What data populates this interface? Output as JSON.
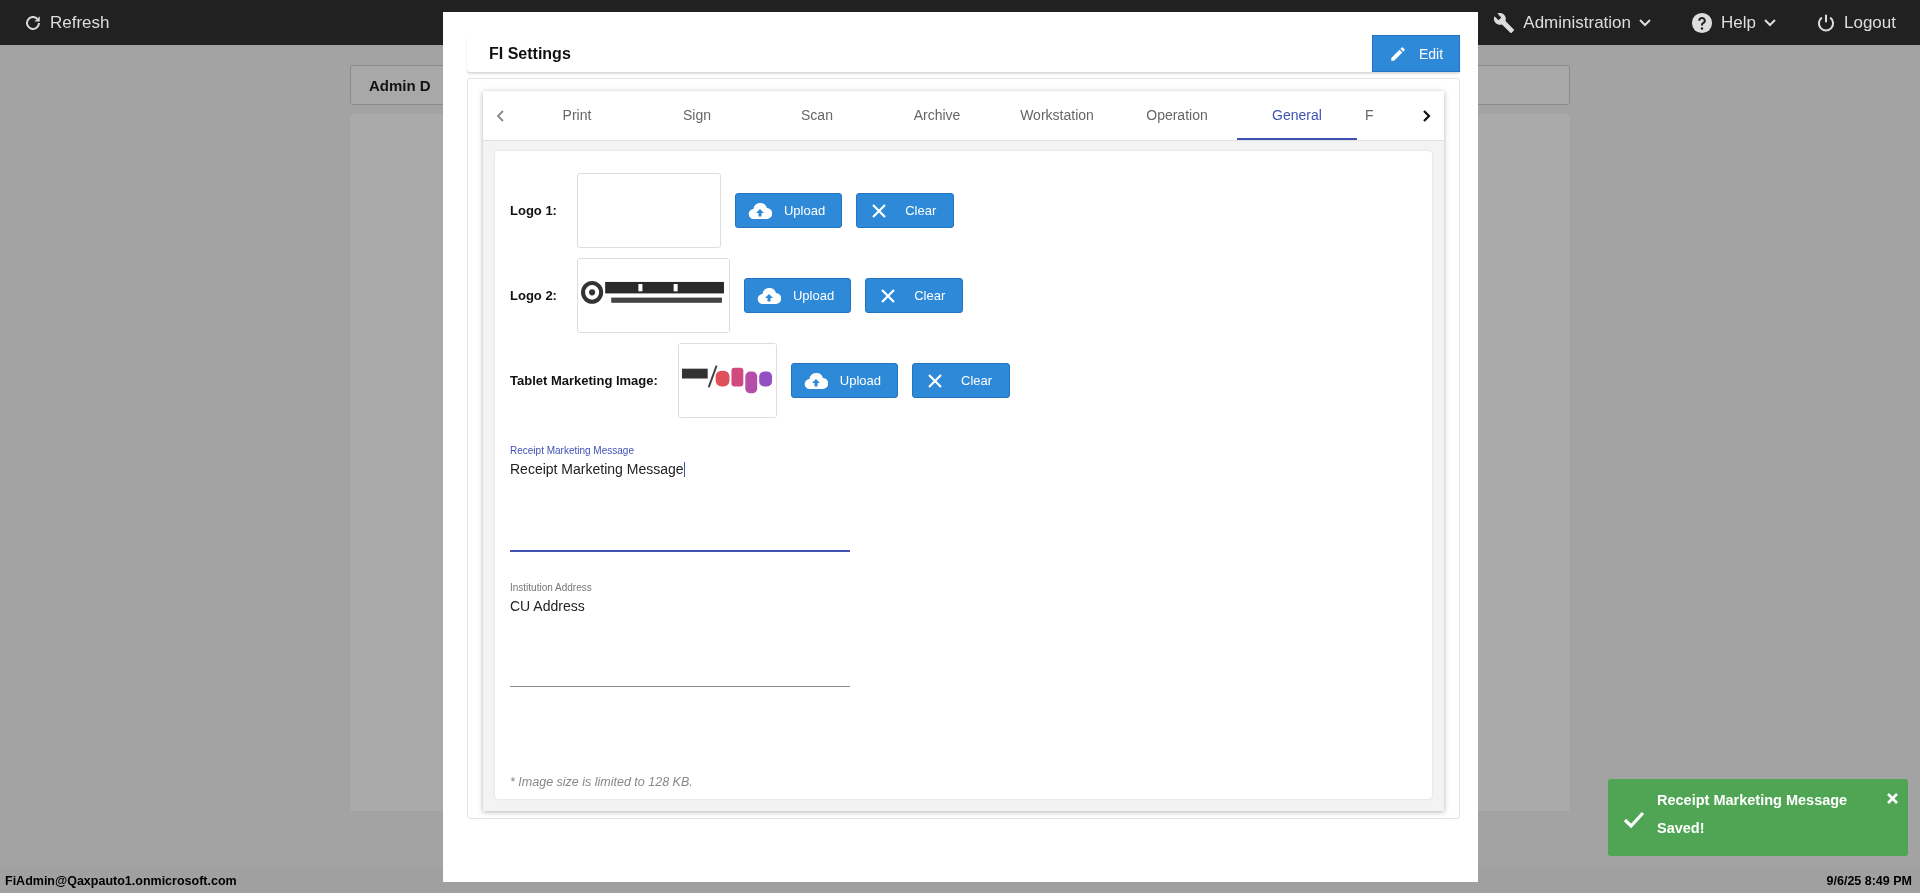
{
  "top_bar": {
    "refresh": "Refresh",
    "menus": [
      {
        "label": "Administration",
        "kind": "admin"
      },
      {
        "label": "Help",
        "kind": "help"
      }
    ],
    "logout": "Logout"
  },
  "admin_panel": {
    "title": "Admin D"
  },
  "status_bar": {
    "user": "FiAdmin@Qaxpauto1.onmicrosoft.com",
    "datetime": "9/6/25 8:49 PM"
  },
  "dialog": {
    "title": "FI Settings",
    "edit_button": "Edit",
    "tabs": [
      {
        "label": "Print",
        "selected": false
      },
      {
        "label": "Sign",
        "selected": false
      },
      {
        "label": "Scan",
        "selected": false
      },
      {
        "label": "Archive",
        "selected": false
      },
      {
        "label": "Workstation",
        "selected": false
      },
      {
        "label": "Operation",
        "selected": false
      },
      {
        "label": "General",
        "selected": true
      },
      {
        "label": "F",
        "selected": false
      }
    ],
    "images": [
      {
        "label": "Logo 1:",
        "preview": {
          "kind": "empty"
        },
        "buttons": [
          {
            "label": "Upload",
            "kind": "upload"
          },
          {
            "label": "Clear",
            "kind": "clear"
          }
        ]
      },
      {
        "label": "Logo 2:",
        "preview": {
          "kind": "picture"
        },
        "buttons": [
          {
            "label": "Upload",
            "kind": "upload"
          },
          {
            "label": "Clear",
            "kind": "clear"
          }
        ]
      },
      {
        "label": "Tablet Marketing Image:",
        "preview": {
          "kind": "picture"
        },
        "buttons": [
          {
            "label": "Upload",
            "kind": "upload"
          },
          {
            "label": "Clear",
            "kind": "clear"
          }
        ]
      }
    ],
    "fields": [
      {
        "label": "Receipt Marketing Message",
        "value": "Receipt Marketing Message",
        "focused": true
      },
      {
        "label": "Institution Address",
        "value": "CU Address",
        "focused": false
      }
    ],
    "note": "* Image size is limited to 128 KB."
  },
  "toast": {
    "message": "Receipt Marketing Message Saved!"
  }
}
